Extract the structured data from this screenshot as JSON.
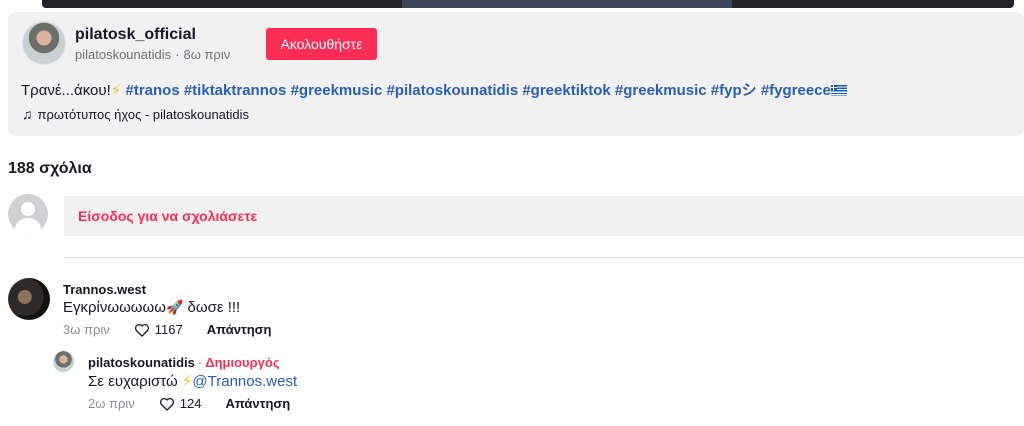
{
  "post": {
    "author_username": "pilatosk_official",
    "author_nickname": "pilatoskounatidis",
    "posted_ago": "8ω πριν",
    "follow_label": "Ακολουθήστε",
    "caption_prefix": "Τρανέ...άκου!",
    "hashtags": [
      "#tranos",
      "#tiktaktrannos",
      "#greekmusic",
      "#pilatoskounatidis",
      "#greektiktok",
      "#greekmusic",
      "#fypシ",
      "#fygreece"
    ],
    "music": "πρωτότυπος ήχος - pilatoskounatidis"
  },
  "comments_section": {
    "count_label": "188 σχόλια",
    "login_prompt": "Είσοδος για να σχολιάσετε"
  },
  "comments": [
    {
      "username": "Trannos.west",
      "text": "Εγκρίνωωωωω",
      "text_suffix": " δωσε !!!",
      "time": "3ω πριν",
      "likes": "1167",
      "reply_label": "Απάντηση"
    },
    {
      "username": "pilatoskounatidis",
      "badge": "Δημιουργός",
      "text": "Σε ευχαριστώ ",
      "mention": "@Trannos.west",
      "time": "2ω πριν",
      "likes": "124",
      "reply_label": "Απάντηση"
    }
  ],
  "icons": {
    "bolt": "high-voltage-emoji",
    "rocket": "rocket-emoji",
    "music": "music-note-icon",
    "like": "heart-outline-icon",
    "flag": "greece-flag-emoji"
  },
  "colors": {
    "accent": "#fe2c55",
    "hashtag": "#2b5db9",
    "card_bg": "#f1f1f2"
  }
}
